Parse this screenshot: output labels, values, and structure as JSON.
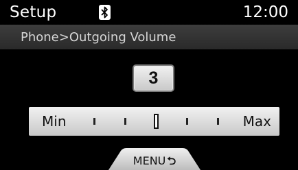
{
  "header": {
    "title": "Setup",
    "bluetooth_icon": "bluetooth-icon",
    "time": "12:00"
  },
  "breadcrumb": "Phone>Outgoing Volume",
  "volume": {
    "value": "3",
    "level": 3,
    "positions": 6,
    "min_label": "Min",
    "max_label": "Max"
  },
  "menu": {
    "label": "MENU",
    "icon": "return-arrow-icon",
    "icon_glyph": "⮌"
  },
  "colors": {
    "background": "#000000",
    "breadcrumb_bar": "#333333",
    "panel": "#dcdcdc",
    "text_light": "#ffffff"
  }
}
